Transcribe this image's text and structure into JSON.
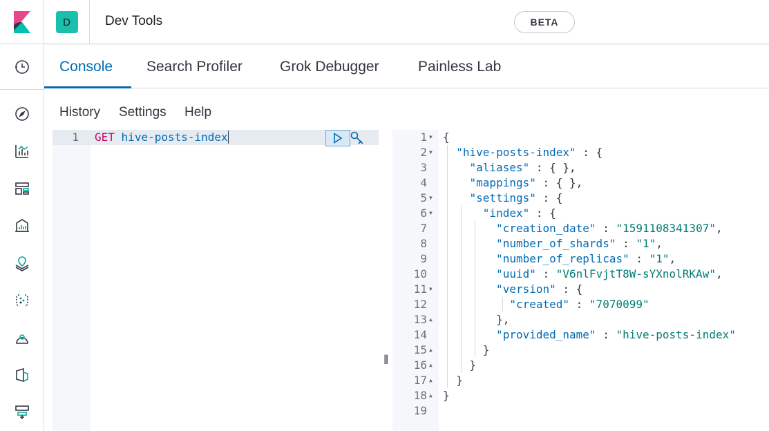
{
  "header": {
    "space_initial": "D",
    "app_title": "Dev Tools"
  },
  "sidebar": {
    "items": [
      {
        "icon": "clock-icon",
        "label": "Recently viewed"
      },
      {
        "icon": "compass-icon",
        "label": "Discover"
      },
      {
        "icon": "visualize-icon",
        "label": "Visualize"
      },
      {
        "icon": "dashboard-icon",
        "label": "Dashboard"
      },
      {
        "icon": "canvas-icon",
        "label": "Canvas"
      },
      {
        "icon": "maps-icon",
        "label": "Maps"
      },
      {
        "icon": "ml-icon",
        "label": "Machine Learning"
      },
      {
        "icon": "metrics-icon",
        "label": "Metrics"
      },
      {
        "icon": "logs-icon",
        "label": "Logs"
      },
      {
        "icon": "dev-tools-icon",
        "label": "Dev Tools"
      }
    ]
  },
  "tabs": [
    {
      "label": "Console",
      "active": true
    },
    {
      "label": "Search Profiler",
      "active": false
    },
    {
      "label": "Grok Debugger",
      "active": false
    },
    {
      "label": "Painless Lab",
      "active": false
    }
  ],
  "beta_badge": "BETA",
  "console_menu": {
    "history": "History",
    "settings": "Settings",
    "help": "Help"
  },
  "request": {
    "line_number": "1",
    "method": "GET",
    "path": "hive-posts-index"
  },
  "response": {
    "lines": [
      {
        "n": "1",
        "fold": "open",
        "code": "{"
      },
      {
        "n": "2",
        "fold": "open",
        "code": "  \"hive-posts-index\" : {"
      },
      {
        "n": "3",
        "fold": "",
        "code": "    \"aliases\" : { },"
      },
      {
        "n": "4",
        "fold": "",
        "code": "    \"mappings\" : { },"
      },
      {
        "n": "5",
        "fold": "open",
        "code": "    \"settings\" : {"
      },
      {
        "n": "6",
        "fold": "open",
        "code": "      \"index\" : {"
      },
      {
        "n": "7",
        "fold": "",
        "code": "        \"creation_date\" : \"1591108341307\","
      },
      {
        "n": "8",
        "fold": "",
        "code": "        \"number_of_shards\" : \"1\","
      },
      {
        "n": "9",
        "fold": "",
        "code": "        \"number_of_replicas\" : \"1\","
      },
      {
        "n": "10",
        "fold": "",
        "code": "        \"uuid\" : \"V6nlFvjtT8W-sYXnolRKAw\","
      },
      {
        "n": "11",
        "fold": "open",
        "code": "        \"version\" : {"
      },
      {
        "n": "12",
        "fold": "",
        "code": "          \"created\" : \"7070099\""
      },
      {
        "n": "13",
        "fold": "close",
        "code": "        },"
      },
      {
        "n": "14",
        "fold": "",
        "code": "        \"provided_name\" : \"hive-posts-index\""
      },
      {
        "n": "15",
        "fold": "close",
        "code": "      }"
      },
      {
        "n": "16",
        "fold": "close",
        "code": "    }"
      },
      {
        "n": "17",
        "fold": "close",
        "code": "  }"
      },
      {
        "n": "18",
        "fold": "close",
        "code": "}"
      },
      {
        "n": "19",
        "fold": "",
        "code": ""
      }
    ]
  },
  "colors": {
    "accent": "#006bb4",
    "space_avatar": "#1bbfae",
    "http_method": "#c80a68",
    "json_string": "#017d73"
  }
}
